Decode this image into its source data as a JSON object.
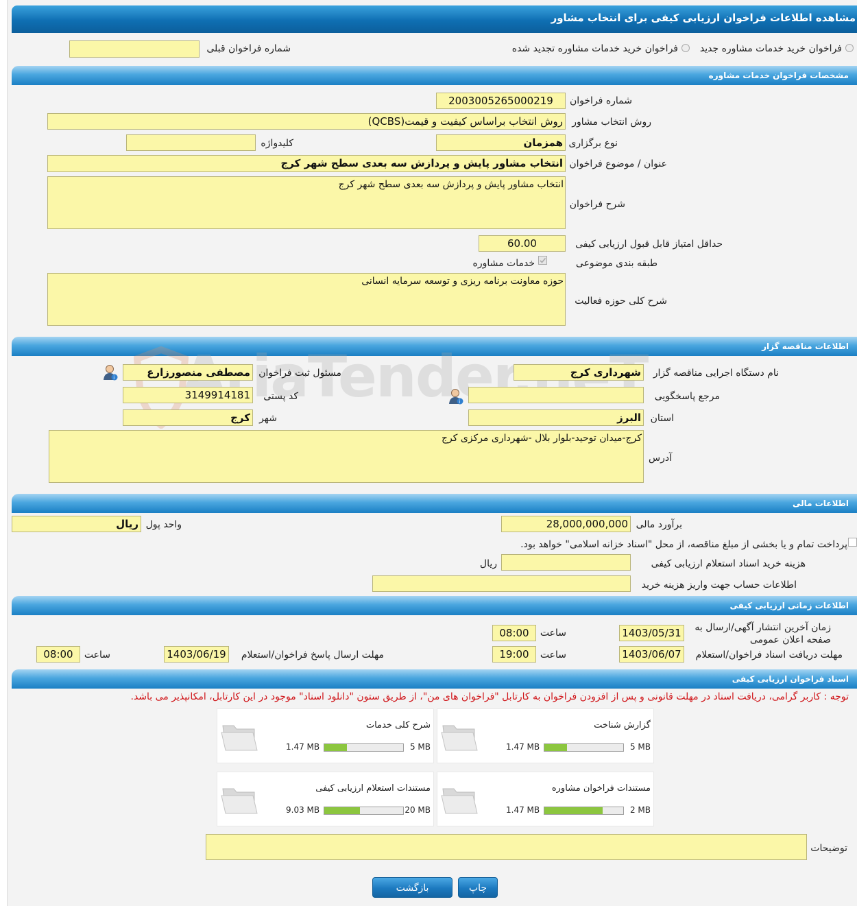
{
  "page": {
    "title": "مشاهده اطلاعات فراخوان ارزیابی کیفی برای انتخاب مشاور"
  },
  "top": {
    "radio1": "فراخوان خرید خدمات مشاوره جدید",
    "radio2": "فراخوان خرید خدمات مشاوره تجدید شده",
    "prev_label": "شماره فراخوان قبلی",
    "prev_value": ""
  },
  "sections": {
    "specs": "مشخصات فراخوان خدمات مشاوره",
    "tenderer": "اطلاعات مناقصه گزار",
    "financial": "اطلاعات مالی",
    "timing": "اطلاعات زمانی ارزیابی کیفی",
    "docs": "اسناد فراخوان ارزیابی کیفی"
  },
  "specs": {
    "number_label": "شماره فراخوان",
    "number": "2003005265000219",
    "method_label": "روش انتخاب مشاور",
    "method": "روش انتخاب براساس کیفیت و قیمت(QCBS)",
    "type_label": "نوع برگزاری",
    "type": "همزمان",
    "keyword_label": "کلیدواژه",
    "keyword": "",
    "subject_label": "عنوان / موضوع فراخوان",
    "subject": "انتخاب مشاور پایش و پردازش سه بعدی سطح شهر کرج",
    "desc_label": "شرح فراخوان",
    "desc": "انتخاب مشاور پایش و پردازش سه بعدی سطح شهر کرج",
    "min_score_label": "حداقل امتیاز قابل قبول ارزیابی کیفی",
    "min_score": "60.00",
    "category_label": "طبقه بندی موضوعی",
    "category": "خدمات مشاوره",
    "activity_label": "شرح کلی حوزه فعالیت",
    "activity": "حوزه معاونت برنامه ریزی و توسعه سرمایه انسانی"
  },
  "tenderer": {
    "org_label": "نام دستگاه اجرایی مناقصه گزار",
    "org": "شهرداری کرج",
    "registrar_label": "مسئول ثبت فراخوان",
    "registrar": "مصطفی منصورزارع",
    "ref_label": "مرجع پاسخگویی",
    "ref": "",
    "postal_label": "کد پستی",
    "postal": "3149914181",
    "province_label": "استان",
    "province": "البرز",
    "city_label": "شهر",
    "city": "کرج",
    "address_label": "آدرس",
    "address": "کرج-میدان توحید-بلوار بلال -شهرداری مرکزی کرج",
    "watermark": "AriaTender.neT"
  },
  "financial": {
    "estimate_label": "برآورد مالی",
    "estimate": "28,000,000,000",
    "currency_label": "واحد پول",
    "currency": "ریال",
    "treasury_text": "پرداخت تمام و یا بخشی از مبلغ مناقصه، از محل \"اسناد خزانه اسلامی\" خواهد بود.",
    "doc_cost_label": "هزینه خرید اسناد استعلام ارزیابی کیفی",
    "doc_cost": "",
    "doc_cost_unit": "ریال",
    "account_label": "اطلاعات حساب جهت واریز هزینه خرید",
    "account": ""
  },
  "timing": {
    "publish_label_1": "زمان آخرین انتشار آگهی/ارسال به",
    "publish_label_2": "صفحه اعلان عمومی",
    "publish_date": "1403/05/31",
    "time_label": "ساعت",
    "publish_time": "08:00",
    "receive_label": "مهلت دریافت اسناد فراخوان/استعلام",
    "receive_date": "1403/06/07",
    "receive_time": "19:00",
    "reply_label": "مهلت ارسال پاسخ فراخوان/استعلام",
    "reply_date": "1403/06/19",
    "reply_time": "08:00"
  },
  "docs": {
    "notice": "توجه : کاربر گرامی، دریافت اسناد در مهلت قانونی و پس از افزودن فراخوان به کارتابل \"فراخوان های من\"، از طریق ستون \"دانلود اسناد\" موجود در این کارتابل، امکانپذیر می باشد.",
    "files": [
      {
        "name": "گزارش شناخت",
        "current": "1.47 MB",
        "total": "5 MB",
        "progress": 0.29
      },
      {
        "name": "شرح کلی خدمات",
        "current": "1.47 MB",
        "total": "5 MB",
        "progress": 0.29
      },
      {
        "name": "مستندات فراخوان مشاوره",
        "current": "1.47 MB",
        "total": "2 MB",
        "progress": 0.74
      },
      {
        "name": "مستندات استعلام ارزیابی کیفی",
        "current": "9.03 MB",
        "total": "20 MB",
        "progress": 0.45
      }
    ],
    "comments_label": "توضیحات",
    "comments": ""
  },
  "buttons": {
    "print": "چاپ",
    "back": "بازگشت"
  },
  "colors": {
    "header": "#1a7fc4",
    "field": "#fbf7a8",
    "notice": "#d0161a",
    "progress": "#8cc63f"
  }
}
